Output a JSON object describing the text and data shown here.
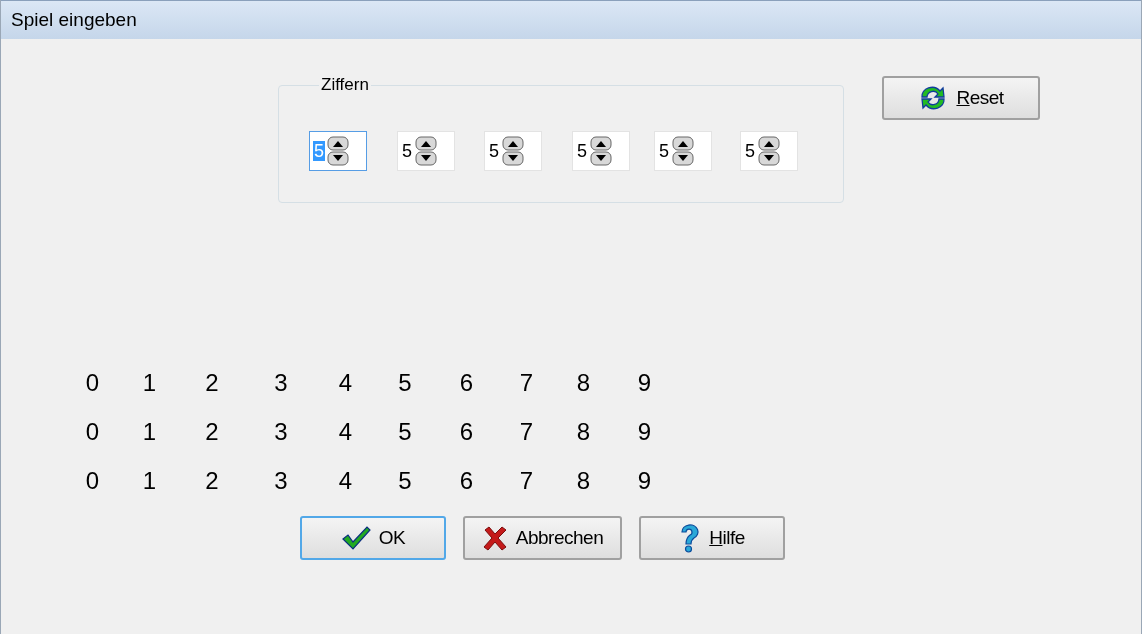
{
  "window": {
    "title": "Spiel eingeben"
  },
  "group": {
    "title": "Ziffern"
  },
  "digits": [
    {
      "value": "5",
      "focused": true
    },
    {
      "value": "5",
      "focused": false
    },
    {
      "value": "5",
      "focused": false
    },
    {
      "value": "5",
      "focused": false
    },
    {
      "value": "5",
      "focused": false
    },
    {
      "value": "5",
      "focused": false
    }
  ],
  "reset_button": {
    "label": "Reset",
    "kind": "refresh",
    "underline_first": true,
    "default": false
  },
  "digit_rows": [
    [
      "0",
      "1",
      "2",
      "3",
      "4",
      "5",
      "6",
      "7",
      "8",
      "9"
    ],
    [
      "0",
      "1",
      "2",
      "3",
      "4",
      "5",
      "6",
      "7",
      "8",
      "9"
    ],
    [
      "0",
      "1",
      "2",
      "3",
      "4",
      "5",
      "6",
      "7",
      "8",
      "9"
    ]
  ],
  "buttons": [
    {
      "label": "OK",
      "kind": "confirm",
      "underline_first": false,
      "default": true
    },
    {
      "label": "Abbrechen",
      "kind": "cancel",
      "underline_first": false,
      "default": false
    },
    {
      "label": "Hilfe",
      "kind": "help",
      "underline_first": true,
      "default": false
    }
  ]
}
